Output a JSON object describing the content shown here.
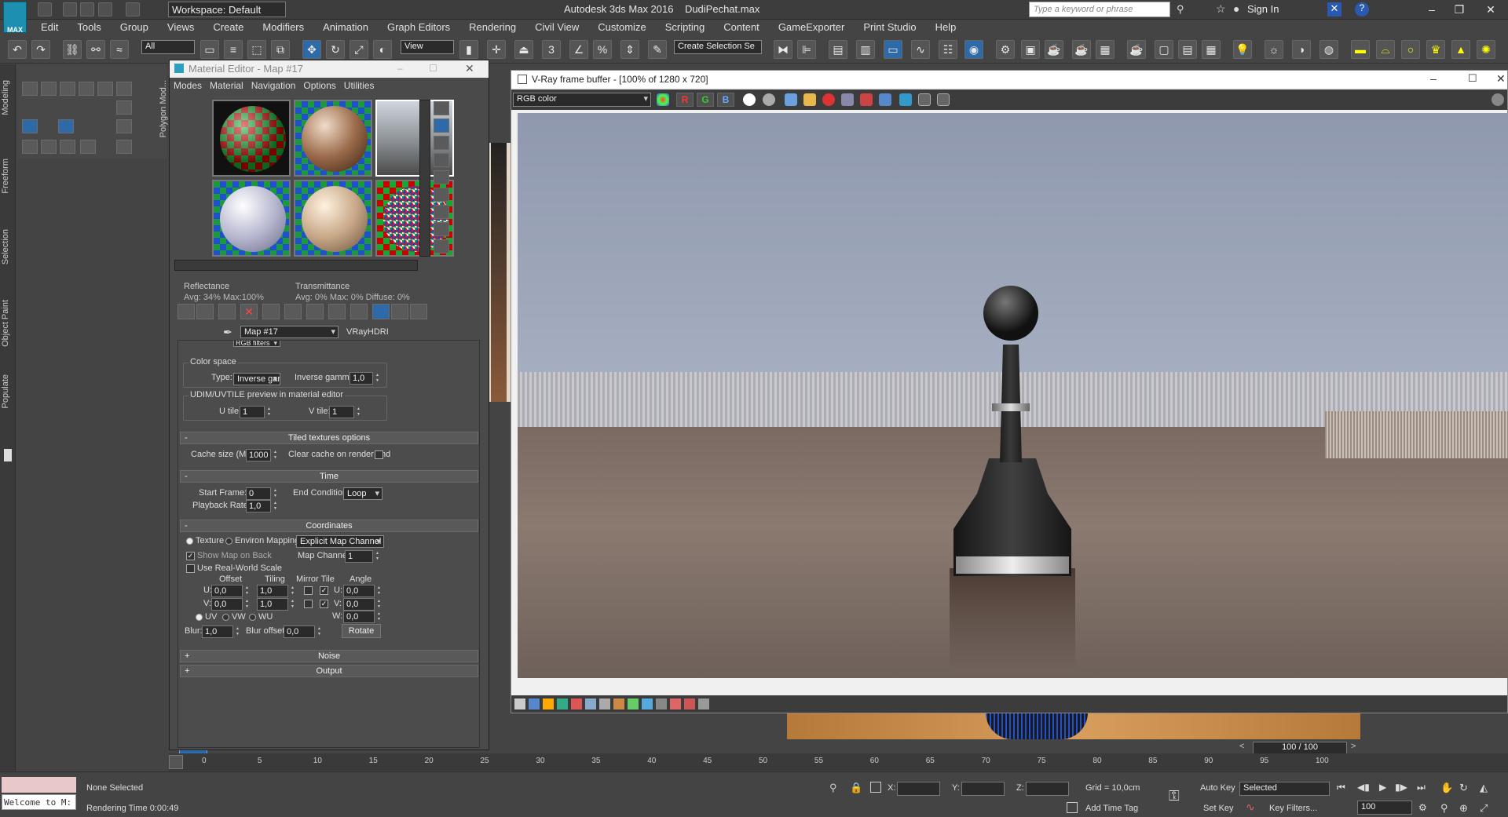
{
  "app": {
    "logo_text": "MAX",
    "title": "Autodesk 3ds Max 2016",
    "file": "DudiPechat.max"
  },
  "workspace": {
    "label": "Workspace: Default"
  },
  "search": {
    "placeholder": "Type a keyword or phrase"
  },
  "signin": "Sign In",
  "menu": [
    "Edit",
    "Tools",
    "Group",
    "Views",
    "Create",
    "Modifiers",
    "Animation",
    "Graph Editors",
    "Rendering",
    "Civil View",
    "Customize",
    "Scripting",
    "Content",
    "GameExporter",
    "Print Studio",
    "Help"
  ],
  "toolbar": {
    "filter": "All",
    "coord": "View",
    "selection_set": "Create Selection Se"
  },
  "left_tabs": [
    "Modeling",
    "Freeform",
    "Selection",
    "Object Paint",
    "Populate"
  ],
  "ribbon": {
    "label": "Polygon Mod..."
  },
  "material_editor": {
    "title": "Material Editor - Map #17",
    "menu": [
      "Modes",
      "Material",
      "Navigation",
      "Options",
      "Utilities"
    ],
    "reflectance": {
      "label": "Reflectance",
      "value": "Avg:  34% Max:100%"
    },
    "transmittance": {
      "label": "Transmittance",
      "value": "Avg:   0% Max:   0%  Diffuse:   0%"
    },
    "map_name": "Map #17",
    "map_type": "VRayHDRI",
    "partial_dropdown": "RGB filters",
    "color_space": {
      "title": "Color space",
      "type_label": "Type:",
      "type_value": "Inverse gar",
      "gamma_label": "Inverse gamma:",
      "gamma_value": "1,0"
    },
    "udim": {
      "title": "UDIM/UVTILE preview in material editor",
      "u_label": "U tile:",
      "u_value": "1",
      "v_label": "V tile:",
      "v_value": "1"
    },
    "tiled": {
      "title": "Tiled textures options",
      "cache_label": "Cache size (MB):",
      "cache_value": "1000",
      "clear_label": "Clear cache on render end"
    },
    "time": {
      "title": "Time",
      "start_label": "Start Frame:",
      "start_value": "0",
      "end_label": "End Condition:",
      "end_value": "Loop",
      "rate_label": "Playback Rate:",
      "rate_value": "1,0"
    },
    "coords": {
      "title": "Coordinates",
      "texture": "Texture",
      "environ": "Environ",
      "mapping_label": "Mapping:",
      "mapping_value": "Explicit Map Channel",
      "show_map": "Show Map on Back",
      "channel_label": "Map Channel:",
      "channel_value": "1",
      "real_world": "Use Real-World Scale",
      "offset": "Offset",
      "tiling": "Tiling",
      "mirror_tile": "Mirror Tile",
      "angle": "Angle",
      "u": "U:",
      "v": "V:",
      "w": "W:",
      "u_offset": "0,0",
      "v_offset": "0,0",
      "u_tiling": "1,0",
      "v_tiling": "1,0",
      "u_angle": "0,0",
      "v_angle": "0,0",
      "w_angle": "0,0",
      "uv": "UV",
      "vw": "VW",
      "wu": "WU",
      "blur_label": "Blur:",
      "blur_value": "1,0",
      "blur_offset_label": "Blur offset:",
      "blur_offset_value": "0,0",
      "rotate": "Rotate"
    },
    "noise": "Noise",
    "output": "Output"
  },
  "vfb": {
    "title": "V-Ray frame buffer - [100% of 1280 x 720]",
    "channel": "RGB color",
    "r": "R",
    "g": "G",
    "b": "B"
  },
  "timeline": {
    "frame": "100 / 100",
    "ticks": [
      "0",
      "5",
      "10",
      "15",
      "20",
      "25",
      "30",
      "35",
      "40",
      "45",
      "50",
      "55",
      "60",
      "65",
      "70",
      "75",
      "80",
      "85",
      "90",
      "95",
      "100"
    ]
  },
  "status": {
    "welcome": "Welcome to M:",
    "selected": "None Selected",
    "rendering_time": "Rendering Time  0:00:49",
    "x": "X:",
    "y": "Y:",
    "z": "Z:",
    "grid": "Grid = 10,0cm",
    "add_time_tag": "Add Time Tag",
    "auto_key": "Auto Key",
    "set_key": "Set Key",
    "selected_dd": "Selected",
    "key_filters": "Key Filters...",
    "frame_value": "100"
  }
}
